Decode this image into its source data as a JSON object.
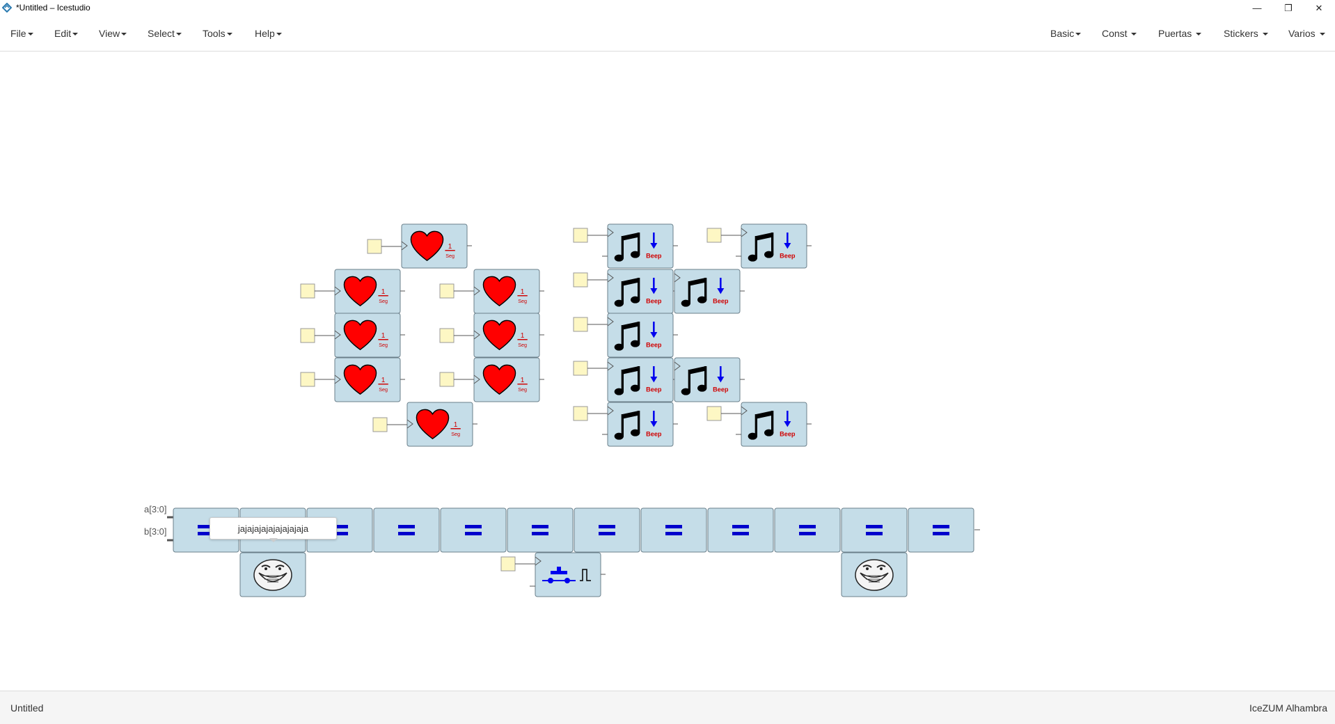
{
  "window": {
    "title": "*Untitled – Icestudio",
    "controls": [
      "minimize-icon",
      "restore-icon",
      "close-icon"
    ]
  },
  "menu": {
    "left": [
      {
        "label": "File"
      },
      {
        "label": "Edit"
      },
      {
        "label": "View"
      },
      {
        "label": "Select"
      },
      {
        "label": "Tools"
      },
      {
        "label": "Help"
      }
    ],
    "right": [
      {
        "label": "Basic"
      },
      {
        "label": "Const"
      },
      {
        "label": "Puertas"
      },
      {
        "label": "Stickers"
      },
      {
        "label": "Varios"
      }
    ]
  },
  "canvas": {
    "heart_label": {
      "num": "1",
      "unit": "Seg"
    },
    "beep_label": "Beep",
    "compare_inputs": {
      "a": "a[3:0]",
      "b": "b[3:0]"
    },
    "compare_block_count": 12,
    "tooltip_text": "jajajajajajajajajaja"
  },
  "footer": {
    "left": "Untitled",
    "right": "IceZUM Alhambra"
  },
  "colors": {
    "block_fill": "#c5dde8",
    "block_stroke": "#6a7f8a",
    "const_fill": "#fdf7c4",
    "heart": "#ff0000",
    "equal_sign": "#0000cc"
  }
}
